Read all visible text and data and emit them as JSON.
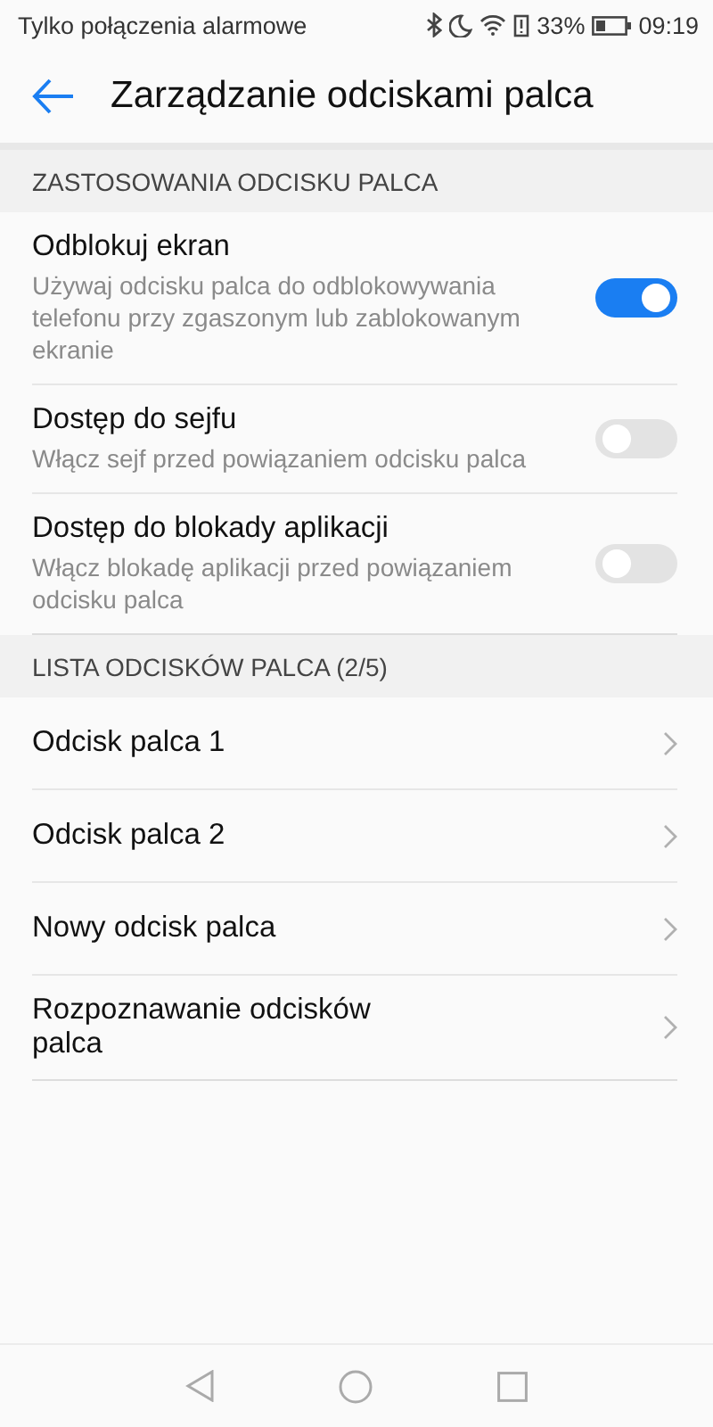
{
  "status_bar": {
    "carrier": "Tylko połączenia alarmowe",
    "battery_percent": "33%",
    "time": "09:19"
  },
  "app_bar": {
    "title": "Zarządzanie odciskami palca"
  },
  "sections": [
    {
      "header": "ZASTOSOWANIA ODCISKU PALCA",
      "items": [
        {
          "kind": "toggle",
          "title": "Odblokuj ekran",
          "subtitle": "Używaj odcisku palca do odblokowywania telefonu przy zgaszonym lub zablokowanym ekranie",
          "on": true
        },
        {
          "kind": "toggle",
          "title": "Dostęp do sejfu",
          "subtitle": "Włącz sejf przed powiązaniem odcisku palca",
          "on": false
        },
        {
          "kind": "toggle",
          "title": "Dostęp do blokady aplikacji",
          "subtitle": "Włącz blokadę aplikacji przed powiązaniem odcisku palca",
          "on": false
        }
      ]
    },
    {
      "header": "LISTA ODCISKÓW PALCA (2/5)",
      "items": [
        {
          "kind": "link",
          "title": "Odcisk palca 1"
        },
        {
          "kind": "link",
          "title": "Odcisk palca 2"
        },
        {
          "kind": "link",
          "title": "Nowy odcisk palca"
        },
        {
          "kind": "link",
          "title": "Rozpoznawanie odcisków palca"
        }
      ]
    }
  ]
}
